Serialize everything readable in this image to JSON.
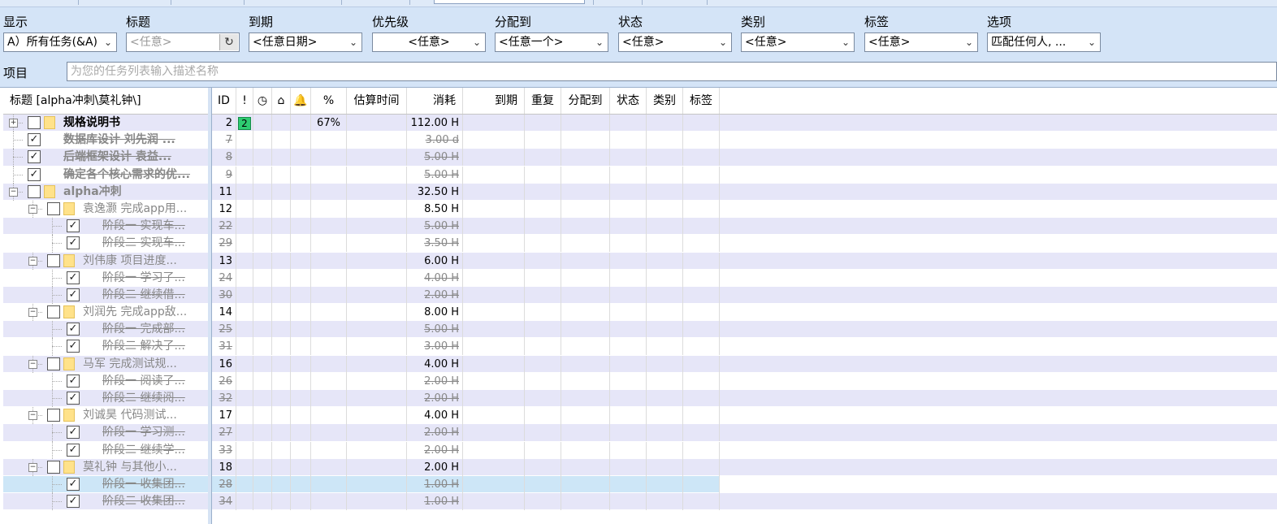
{
  "filters": [
    {
      "label": "显示",
      "value": "A）所有任务(&A)",
      "type": "select"
    },
    {
      "label": "标题",
      "value": "<任意>",
      "type": "text"
    },
    {
      "label": "到期",
      "value": "<任意日期>",
      "type": "select"
    },
    {
      "label": "优先级",
      "value": "<任意>",
      "type": "select"
    },
    {
      "label": "分配到",
      "value": "<任意一个>",
      "type": "select"
    },
    {
      "label": "状态",
      "value": "<任意>",
      "type": "select"
    },
    {
      "label": "类别",
      "value": "<任意>",
      "type": "select"
    },
    {
      "label": "标签",
      "value": "<任意>",
      "type": "select"
    },
    {
      "label": "选项",
      "value": "匹配任何人, ...",
      "type": "select"
    }
  ],
  "project": {
    "label": "项目",
    "placeholder": "为您的任务列表输入描述名称"
  },
  "tree_header": "标题 [alpha冲刺\\莫礼钟\\]",
  "columns": [
    {
      "key": "id",
      "label": "ID"
    },
    {
      "key": "priority",
      "label": "!",
      "icon": "exclamation-icon"
    },
    {
      "key": "time",
      "label": "◷",
      "icon": "clock-icon"
    },
    {
      "key": "file",
      "label": "⌂",
      "icon": "folder-icon"
    },
    {
      "key": "reminder",
      "label": "🔔",
      "icon": "bell-icon"
    },
    {
      "key": "percent",
      "label": "%"
    },
    {
      "key": "estimate",
      "label": "估算时间"
    },
    {
      "key": "spent",
      "label": "消耗"
    },
    {
      "key": "due",
      "label": "到期"
    },
    {
      "key": "recur",
      "label": "重复"
    },
    {
      "key": "assigned",
      "label": "分配到"
    },
    {
      "key": "status",
      "label": "状态"
    },
    {
      "key": "category",
      "label": "类别"
    },
    {
      "key": "tags",
      "label": "标签"
    }
  ],
  "tasks": [
    {
      "level": 0,
      "expander": "+",
      "checked": false,
      "folder": true,
      "title": "规格说明书",
      "style": "bold",
      "id": "2",
      "priority": "2",
      "percent": "67%",
      "spent": "112.00 H",
      "done": false
    },
    {
      "level": 0,
      "expander": "",
      "checked": true,
      "folder": false,
      "title": "数据库设计   刘先润 ...",
      "style": "strikebold",
      "id": "7",
      "spent": "3.00 d",
      "done": true
    },
    {
      "level": 0,
      "expander": "",
      "checked": true,
      "folder": false,
      "title": "后端框架设计   袁益...",
      "style": "strikebold",
      "id": "8",
      "spent": "5.00 H",
      "done": true
    },
    {
      "level": 0,
      "expander": "",
      "checked": true,
      "folder": false,
      "title": "确定各个核心需求的优...",
      "style": "strikebold",
      "id": "9",
      "spent": "5.00 H",
      "done": true
    },
    {
      "level": 0,
      "expander": "-",
      "checked": false,
      "folder": true,
      "title": "alpha冲刺",
      "style": "boldgray",
      "id": "11",
      "spent": "32.50 H",
      "done": false
    },
    {
      "level": 1,
      "expander": "-",
      "checked": false,
      "folder": true,
      "title": "袁逸灏   完成app用...",
      "style": "gray",
      "id": "12",
      "spent": "8.50 H",
      "done": false
    },
    {
      "level": 2,
      "expander": "",
      "checked": true,
      "folder": false,
      "title": "阶段一   实现车...",
      "style": "strike",
      "id": "22",
      "spent": "5.00 H",
      "done": true
    },
    {
      "level": 2,
      "expander": "",
      "checked": true,
      "folder": false,
      "title": "阶段二   实现车...",
      "style": "strike",
      "id": "29",
      "spent": "3.50 H",
      "done": true
    },
    {
      "level": 1,
      "expander": "-",
      "checked": false,
      "folder": true,
      "title": "刘伟康   项目进度...",
      "style": "gray",
      "id": "13",
      "spent": "6.00 H",
      "done": false
    },
    {
      "level": 2,
      "expander": "",
      "checked": true,
      "folder": false,
      "title": "阶段一   学习了...",
      "style": "strike",
      "id": "24",
      "spent": "4.00 H",
      "done": true
    },
    {
      "level": 2,
      "expander": "",
      "checked": true,
      "folder": false,
      "title": "阶段二   继续借...",
      "style": "strike",
      "id": "30",
      "spent": "2.00 H",
      "done": true
    },
    {
      "level": 1,
      "expander": "-",
      "checked": false,
      "folder": true,
      "title": "刘润先   完成app敌...",
      "style": "gray",
      "id": "14",
      "spent": "8.00 H",
      "done": false
    },
    {
      "level": 2,
      "expander": "",
      "checked": true,
      "folder": false,
      "title": "阶段一   完成部...",
      "style": "strike",
      "id": "25",
      "spent": "5.00 H",
      "done": true
    },
    {
      "level": 2,
      "expander": "",
      "checked": true,
      "folder": false,
      "title": "阶段二   解决了...",
      "style": "strike",
      "id": "31",
      "spent": "3.00 H",
      "done": true
    },
    {
      "level": 1,
      "expander": "-",
      "checked": false,
      "folder": true,
      "title": "马军   完成测试规...",
      "style": "gray",
      "id": "16",
      "spent": "4.00 H",
      "done": false
    },
    {
      "level": 2,
      "expander": "",
      "checked": true,
      "folder": false,
      "title": "阶段一   阅读了...",
      "style": "strike",
      "id": "26",
      "spent": "2.00 H",
      "done": true
    },
    {
      "level": 2,
      "expander": "",
      "checked": true,
      "folder": false,
      "title": "阶段二   继续阅...",
      "style": "strike",
      "id": "32",
      "spent": "2.00 H",
      "done": true
    },
    {
      "level": 1,
      "expander": "-",
      "checked": false,
      "folder": true,
      "title": "刘诚昊   代码测试...",
      "style": "gray",
      "id": "17",
      "spent": "4.00 H",
      "done": false
    },
    {
      "level": 2,
      "expander": "",
      "checked": true,
      "folder": false,
      "title": "阶段一   学习测...",
      "style": "strike",
      "id": "27",
      "spent": "2.00 H",
      "done": true
    },
    {
      "level": 2,
      "expander": "",
      "checked": true,
      "folder": false,
      "title": "阶段二   继续学...",
      "style": "strike",
      "id": "33",
      "spent": "2.00 H",
      "done": true
    },
    {
      "level": 1,
      "expander": "-",
      "checked": false,
      "folder": true,
      "title": "莫礼钟   与其他小...",
      "style": "gray",
      "id": "18",
      "spent": "2.00 H",
      "done": false
    },
    {
      "level": 2,
      "expander": "",
      "checked": true,
      "folder": false,
      "title": "阶段一   收集团...",
      "style": "strike",
      "id": "28",
      "spent": "1.00 H",
      "done": true,
      "selected": true
    },
    {
      "level": 2,
      "expander": "",
      "checked": true,
      "folder": false,
      "title": "阶段二   收集团...",
      "style": "strike",
      "id": "34",
      "spent": "1.00 H",
      "done": true
    }
  ],
  "colors": {
    "row_alt": "#e6e6f8",
    "selected": "#cde6f7",
    "priority_badge": "#2ecc71"
  }
}
